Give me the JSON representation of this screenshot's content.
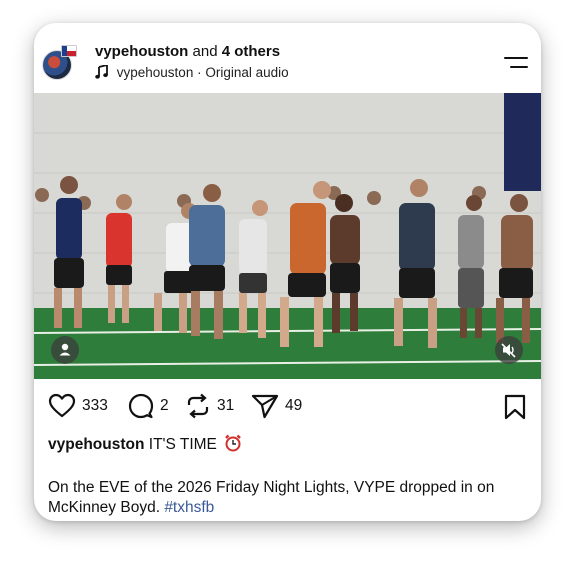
{
  "post": {
    "author": "vypehouston",
    "and_text": "and",
    "others": "4 others",
    "audio_author": "vypehouston",
    "audio_sep": "·",
    "audio_label": "Original audio"
  },
  "actions": {
    "likes": "333",
    "comments": "2",
    "reposts": "31",
    "shares": "49"
  },
  "caption": {
    "user": "vypehouston",
    "text": "IT'S TIME",
    "emoji": "alarm-clock-icon"
  },
  "description": {
    "text": "On the EVE of the 2026 Friday Night Lights, VYPE dropped in on McKinney Boyd.",
    "hashtag": "#txhsfb"
  },
  "colors": {
    "hashtag": "#3b5998",
    "field": "#2f7d3a",
    "wall": "#d9d9d6",
    "banner": "#1f2a5a"
  }
}
